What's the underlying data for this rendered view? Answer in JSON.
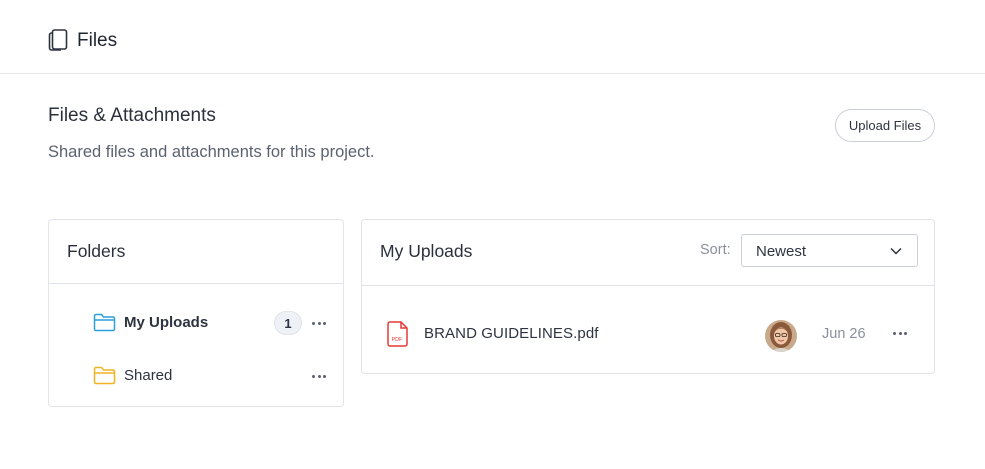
{
  "header": {
    "title": "Files",
    "icon": "files-icon"
  },
  "section": {
    "title": "Files & Attachments",
    "subtitle": "Shared files and attachments for this project.",
    "upload_label": "Upload Files"
  },
  "folders": {
    "title": "Folders",
    "items": [
      {
        "label": "My Uploads",
        "count": "1",
        "icon": "folder-icon",
        "color": "#2b9fd9",
        "active": true
      },
      {
        "label": "Shared",
        "count": "",
        "icon": "folder-icon",
        "color": "#f0b323",
        "active": false
      }
    ]
  },
  "uploads": {
    "title": "My Uploads",
    "sort_label": "Sort:",
    "sort_value": "Newest",
    "files": [
      {
        "name": "BRAND GUIDELINES.pdf",
        "icon": "pdf-icon",
        "icon_text": "PDF",
        "date": "Jun 26",
        "uploader_icon": "avatar"
      }
    ]
  },
  "colors": {
    "accent_blue": "#2b9fd9",
    "folder_yellow": "#f0b323",
    "pdf_red": "#e53935",
    "border": "#e1e4e8"
  }
}
